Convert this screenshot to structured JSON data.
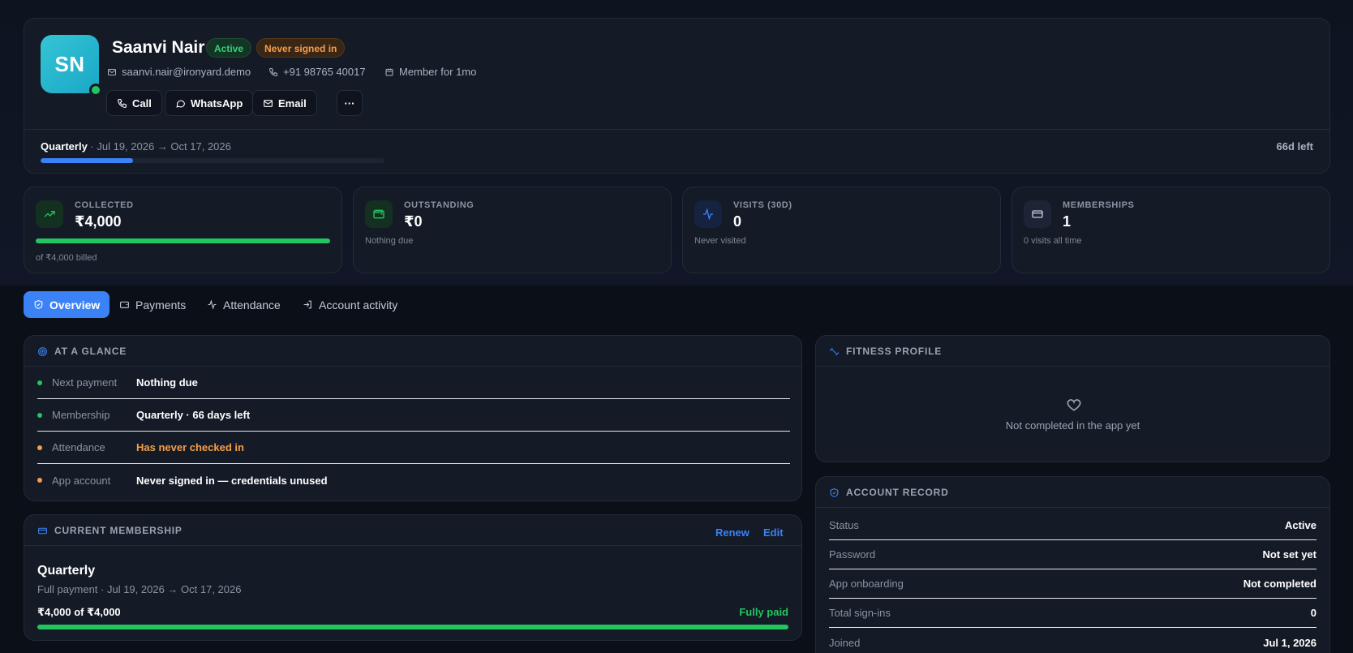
{
  "member": {
    "initials": "SN",
    "name": "Saanvi Nair",
    "status_badge": "Active",
    "signin_badge": "Never signed in",
    "email": "saanvi.nair@ironyard.demo",
    "phone": "+91 98765 40017",
    "member_for": "Member for 1mo"
  },
  "actions": {
    "call": "Call",
    "whatsapp": "WhatsApp",
    "email": "Email",
    "more": "···"
  },
  "plan_bar": {
    "plan": "Quarterly",
    "dates": " · Jul 19, 2026 → Oct 17, 2026",
    "days_left": "66d left",
    "progress": 0.27
  },
  "stats": [
    {
      "label": "COLLECTED",
      "value": "₹4,000",
      "sub": "of ₹4,000 billed",
      "progress": 1.0,
      "icon": "trending-up-icon"
    },
    {
      "label": "OUTSTANDING",
      "value": "₹0",
      "sub": "Nothing due",
      "icon": "wallet-icon"
    },
    {
      "label": "VISITS (30D)",
      "value": "0",
      "sub": "Never visited",
      "icon": "activity-icon"
    },
    {
      "label": "MEMBERSHIPS",
      "value": "1",
      "sub": "0 visits all time",
      "icon": "card-icon"
    }
  ],
  "tabs": [
    {
      "label": "Overview",
      "icon": "shield-icon"
    },
    {
      "label": "Payments",
      "icon": "wallet-icon"
    },
    {
      "label": "Attendance",
      "icon": "activity-icon"
    },
    {
      "label": "Account activity",
      "icon": "login-icon"
    }
  ],
  "glance": {
    "title": "AT A GLANCE",
    "rows": [
      {
        "label": "Next payment",
        "value": "Nothing due",
        "dot": "#22c55e"
      },
      {
        "label": "Membership",
        "value": "Quarterly · 66 days left",
        "dot": "#22c55e"
      },
      {
        "label": "Attendance",
        "value": "Has never checked in",
        "dot": "#f59e4b"
      },
      {
        "label": "App account",
        "value": "Never signed in — credentials unused",
        "dot": "#f59e4b"
      }
    ]
  },
  "current_membership": {
    "title": "CURRENT MEMBERSHIP",
    "renew": "Renew",
    "edit": "Edit",
    "plan": "Quarterly",
    "sub": "Full payment · Jul 19, 2026 → Oct 17, 2026",
    "amount": "₹4,000 of ₹4,000",
    "paid_status": "Fully paid",
    "progress": 1.0
  },
  "fitness": {
    "title": "FITNESS PROFILE",
    "empty": "Not completed in the app yet"
  },
  "record": {
    "title": "ACCOUNT RECORD",
    "rows": [
      {
        "label": "Status",
        "value": "Active"
      },
      {
        "label": "Password",
        "value": "Not set yet"
      },
      {
        "label": "App onboarding",
        "value": "Not completed"
      },
      {
        "label": "Total sign-ins",
        "value": "0"
      },
      {
        "label": "Joined",
        "value": "Jul 1, 2026"
      }
    ]
  },
  "colors": {
    "accent": "#3b82f6",
    "success": "#22c55e",
    "warning": "#f59e4b"
  }
}
